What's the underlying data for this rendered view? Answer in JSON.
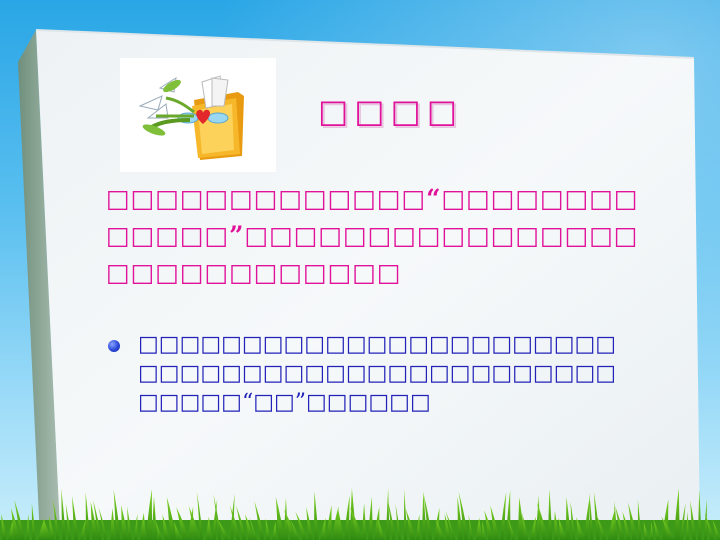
{
  "slide": {
    "title": "□□□□",
    "intro": {
      "part1": "□□□□□□□□□□□□□",
      "open_quote": "“",
      "part2": "□□□□□□□□□□□□□",
      "close_quote": "”",
      "part3": "□□□□□□□□□□□□□□□□□□□□□□□□□□□□"
    },
    "bullet": {
      "part1": "□□□□□□□□□□□□□□□□□□□□□□□□□□□□□□□□□□□□□□□□□□□□□□□□□□□",
      "open_quote": "“",
      "part2": "□□",
      "close_quote": "”",
      "part3": "□□□□□□"
    }
  },
  "colors": {
    "title": "#e0129a",
    "intro_text": "#e0129a",
    "bullet_text": "#2222b8",
    "bullet_dot": "#2a48d8",
    "sky": "#2aa6e6",
    "paper": "#f2f6f8"
  },
  "icons": {
    "clip_art": "folder-with-flowers-clipart",
    "bullet": "blue-dot-bullet"
  }
}
